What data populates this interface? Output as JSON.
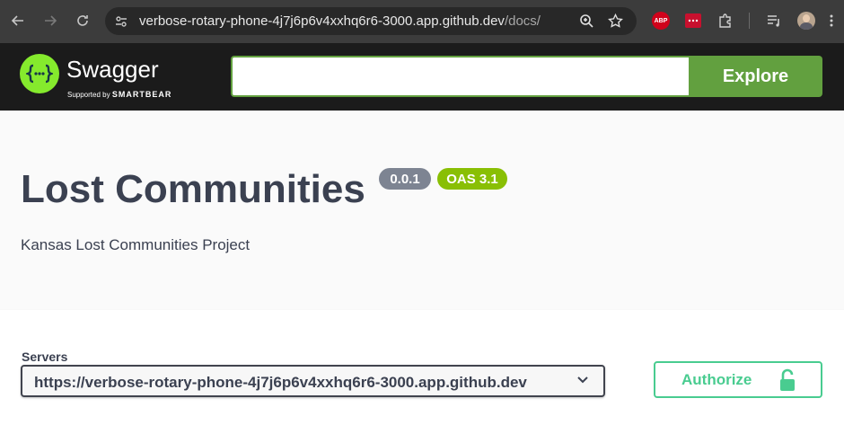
{
  "browser": {
    "url_host": "verbose-rotary-phone-4j7j6p6v4xxhq6r6-3000.app.github.dev",
    "url_path": "/docs/",
    "extensions": {
      "abp_label": "ABP"
    }
  },
  "topbar": {
    "logo_text": "Swagger",
    "logo_sub_prefix": "Supported by",
    "logo_sub_brand": "SMARTBEAR",
    "explore_placeholder": "",
    "explore_label": "Explore",
    "accent_color": "#62a03f"
  },
  "info": {
    "title": "Lost Communities",
    "version": "0.0.1",
    "oas": "OAS 3.1",
    "description": "Kansas Lost Communities Project"
  },
  "servers": {
    "label": "Servers",
    "selected": "https://verbose-rotary-phone-4j7j6p6v4xxhq6r6-3000.app.github.dev"
  },
  "authorize": {
    "label": "Authorize",
    "color": "#49cc90"
  }
}
